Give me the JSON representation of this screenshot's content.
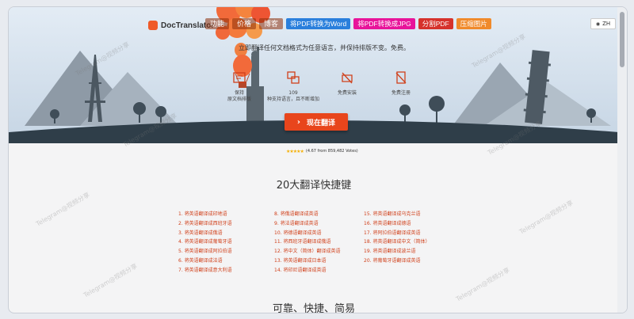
{
  "header": {
    "logo_text": "DocTranslator",
    "nav_links": [
      "功能",
      "价格",
      "博客"
    ],
    "tools": [
      {
        "label": "将PDF转换为Word",
        "color": "#2a7fdc"
      },
      {
        "label": "将PDF转换成JPG",
        "color": "#e8149a"
      },
      {
        "label": "分割PDF",
        "color": "#d6322c"
      },
      {
        "label": "压缩图片",
        "color": "#f08a2b"
      }
    ],
    "language_button": "ZH"
  },
  "hero": {
    "tagline": "立即翻译任何文档格式为任意语言，并保持排版不变。免费。",
    "features": [
      {
        "line1": "保持",
        "line2": "原文档排版"
      },
      {
        "line1": "109",
        "line2": "种支持语言，且不断增加"
      },
      {
        "line1": "",
        "line2": "免费安装"
      },
      {
        "line1": "",
        "line2": "免费注册"
      }
    ],
    "cta_label": "现在翻译",
    "cta_arrow": "›"
  },
  "rating": {
    "stars": "★★★★★",
    "text": "(4.67 from 859,482 Votes)"
  },
  "shortcuts": {
    "title": "20大翻译快捷键",
    "col1": [
      "1. 将英语翻译成印地语",
      "2. 将英语翻译成西班牙语",
      "3. 将英语翻译成俄语",
      "4. 将英语翻译成葡萄牙语",
      "5. 将英语翻译成阿拉伯语",
      "6. 将英语翻译成法语",
      "7. 将英语翻译成意大利语"
    ],
    "col2": [
      "8. 将俄语翻译成英语",
      "9. 将法语翻译成英语",
      "10. 将德语翻译成英语",
      "11. 将西班牙语翻译成俄语",
      "12. 将中文（简体）翻译成英语",
      "13. 将英语翻译成日本语",
      "14. 将印尼语翻译成英语"
    ],
    "col3": [
      "15. 将英语翻译成乌克兰语",
      "16. 将英语翻译成德语",
      "17. 将阿拉伯语翻译成英语",
      "18. 将英语翻译成中文（简体）",
      "19. 将英语翻译成波兰语",
      "20. 将葡萄牙语翻译成英语"
    ]
  },
  "next_section_title": "可靠、快捷、简易",
  "watermark_text": "Telegram@视频分享",
  "colors": {
    "accent": "#e8451c",
    "link": "#d0401b"
  }
}
